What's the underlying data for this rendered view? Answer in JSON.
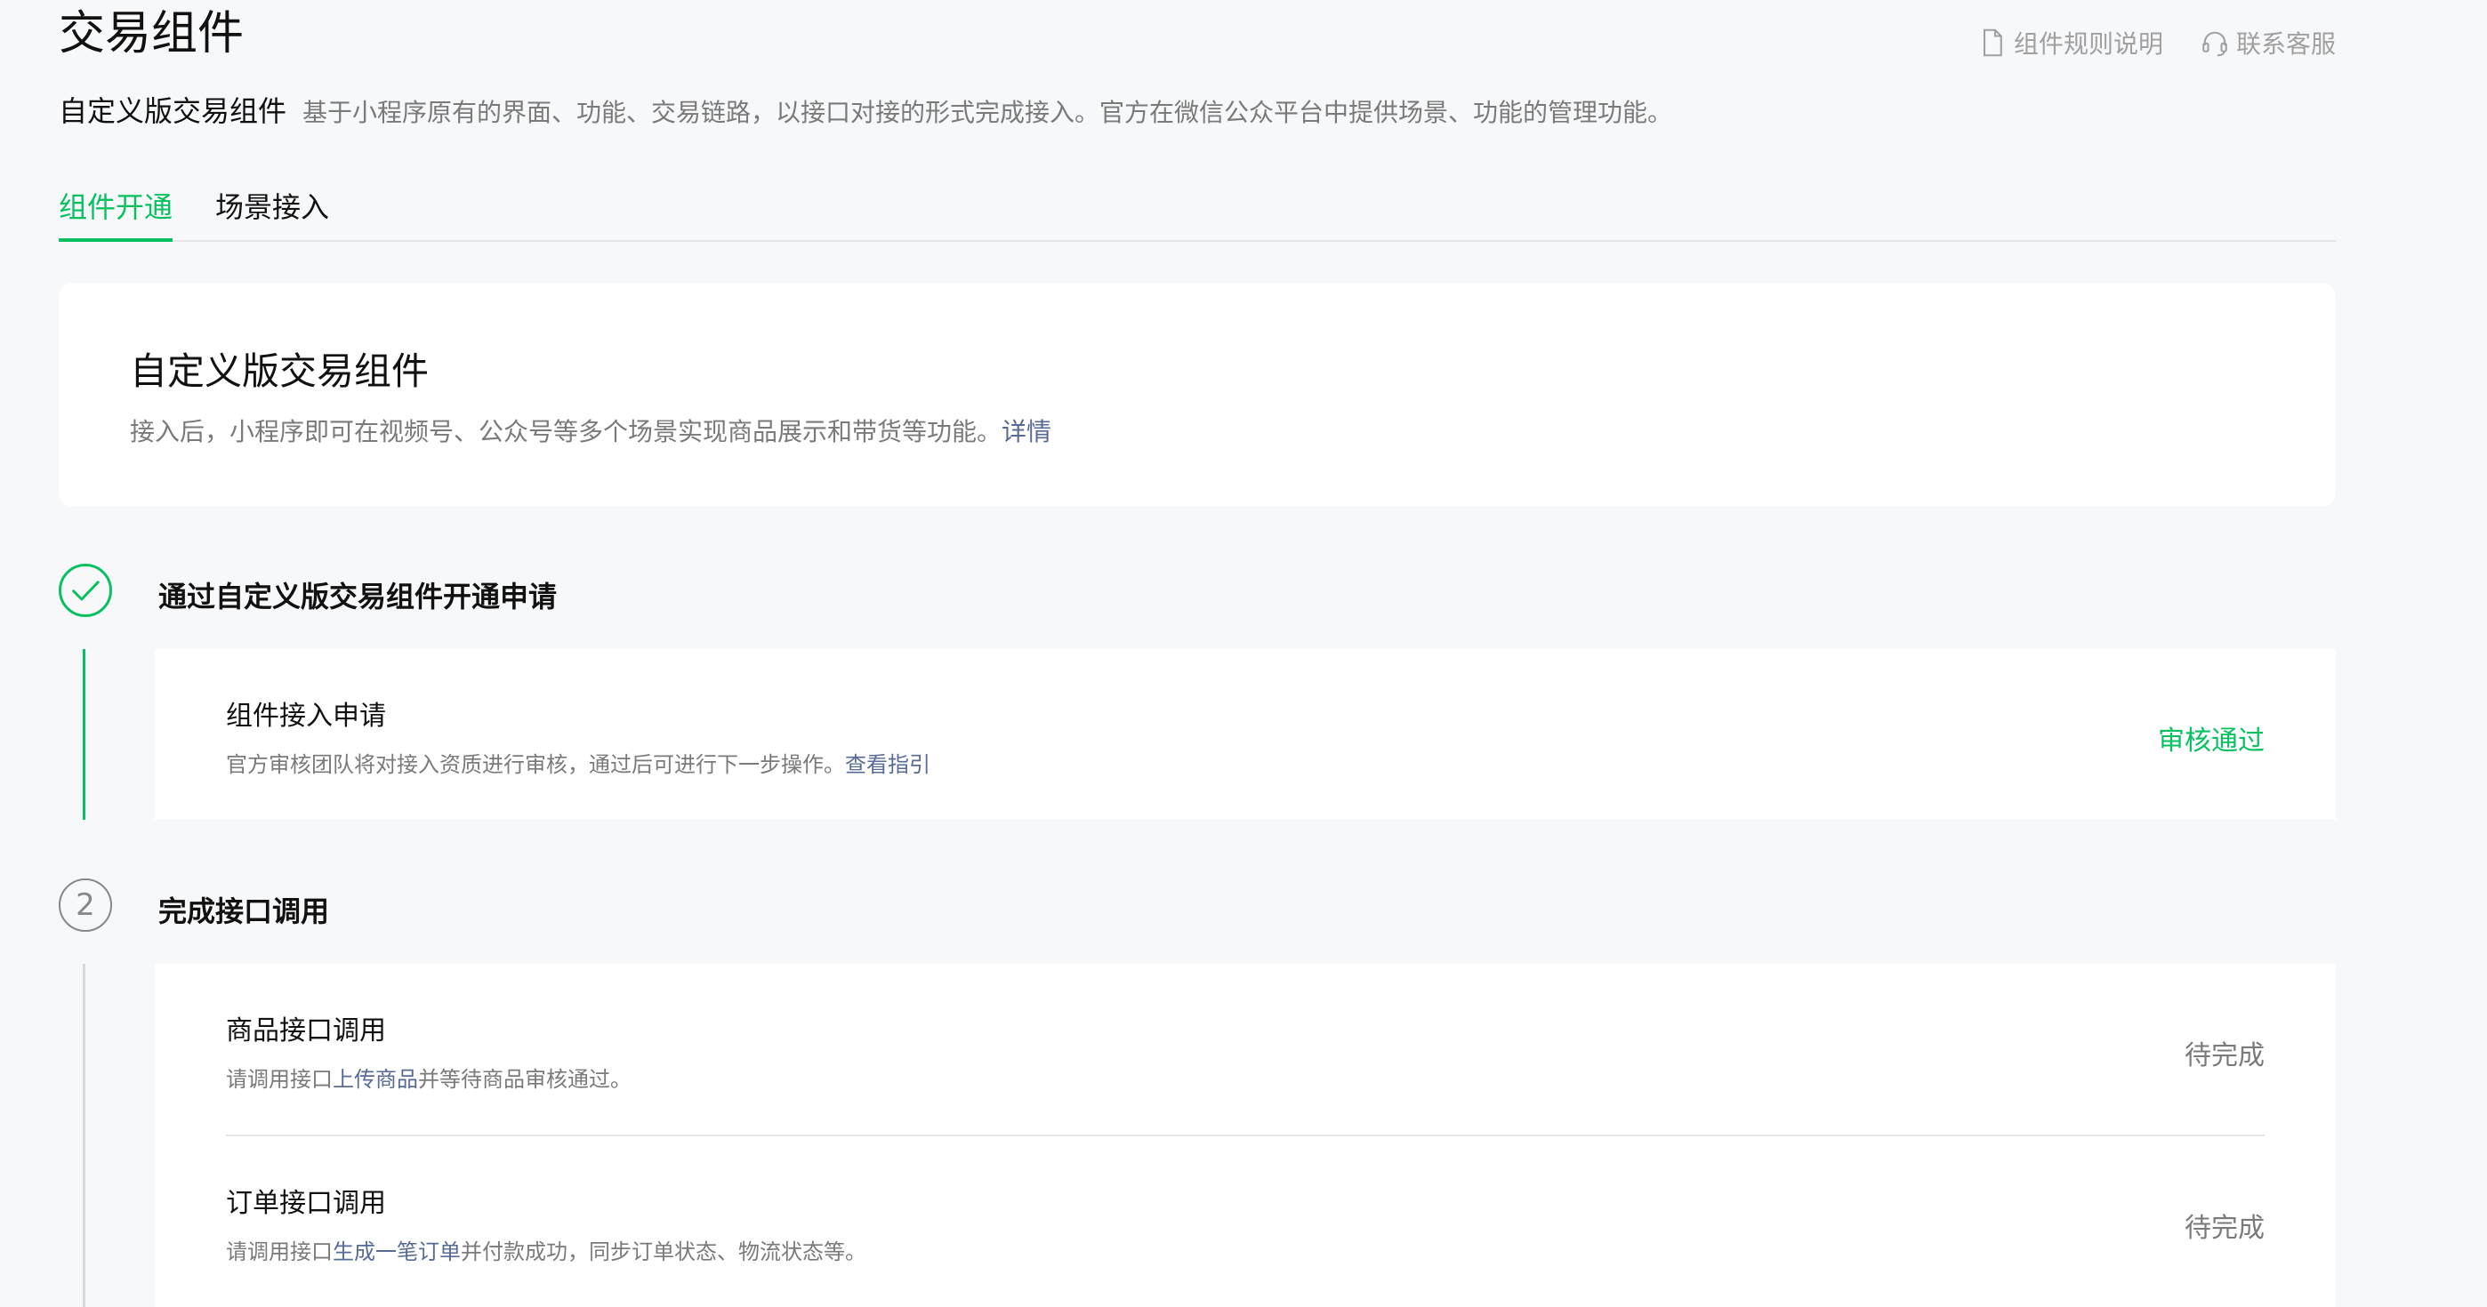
{
  "header": {
    "title": "交易组件",
    "rules_link": "组件规则说明",
    "service_link": "联系客服"
  },
  "subtitle": {
    "strong": "自定义版交易组件",
    "desc": "基于小程序原有的界面、功能、交易链路，以接口对接的形式完成接入。官方在微信公众平台中提供场景、功能的管理功能。"
  },
  "tabs": [
    {
      "label": "组件开通",
      "active": true
    },
    {
      "label": "场景接入",
      "active": false
    }
  ],
  "intro": {
    "title": "自定义版交易组件",
    "desc": "接入后，小程序即可在视频号、公众号等多个场景实现商品展示和带货等功能。",
    "link": "详情"
  },
  "steps": [
    {
      "number": "",
      "status": "done",
      "title": "通过自定义版交易组件开通申请",
      "items": [
        {
          "title": "组件接入申请",
          "desc_before": "官方审核团队将对接入资质进行审核，通过后可进行下一步操作。",
          "link": "查看指引",
          "desc_after": "",
          "status": "审核通过"
        }
      ]
    },
    {
      "number": "2",
      "status": "todo",
      "title": "完成接口调用",
      "items": [
        {
          "title": "商品接口调用",
          "desc_before": "请调用接口",
          "link": "上传商品",
          "desc_after": "并等待商品审核通过。",
          "status": "待完成"
        },
        {
          "title": "订单接口调用",
          "desc_before": "请调用接口",
          "link": "生成一笔订单",
          "desc_after": "并付款成功，同步订单状态、物流状态等。",
          "status": "待完成"
        }
      ]
    }
  ],
  "colors": {
    "accent": "#07c160",
    "link": "#576b95",
    "muted": "#7a7a7a",
    "background": "#f7f8fa"
  },
  "icons": {
    "rules": "document-icon",
    "service": "headset-icon",
    "done": "check-icon"
  }
}
